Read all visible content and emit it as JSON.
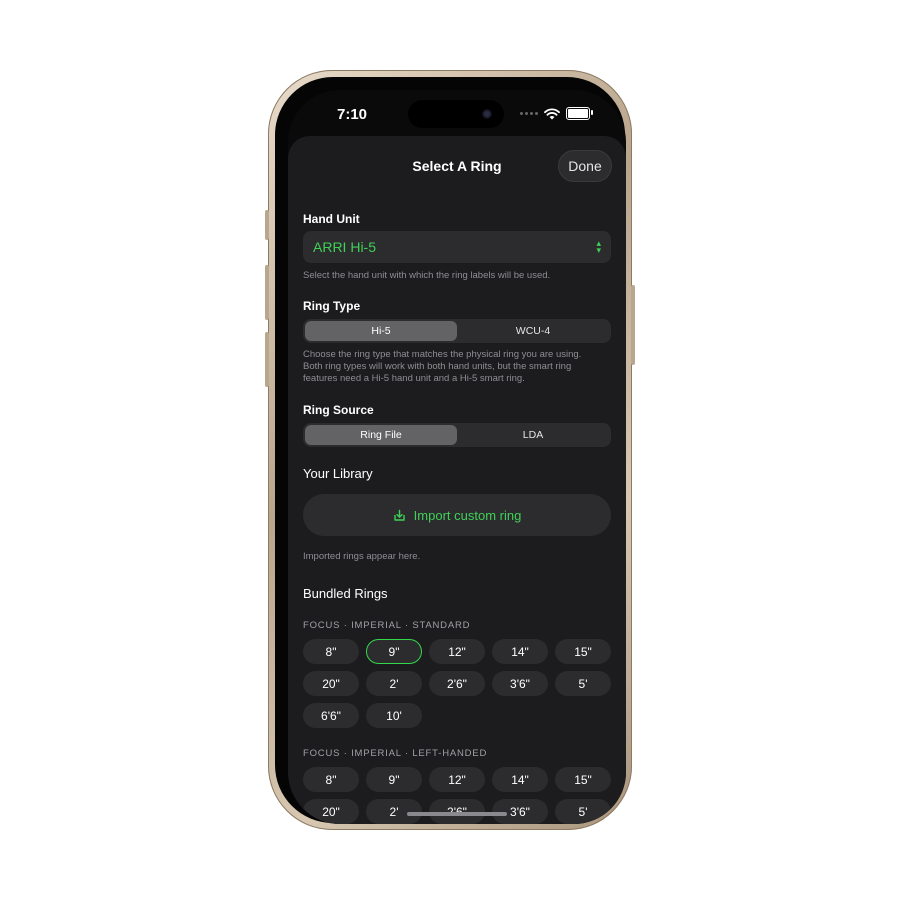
{
  "status_bar": {
    "time": "7:10"
  },
  "header": {
    "title": "Select A Ring",
    "done_label": "Done"
  },
  "hand_unit": {
    "label": "Hand Unit",
    "value": "ARRI Hi-5",
    "helper": "Select the hand unit with which the ring labels will be used."
  },
  "ring_type": {
    "label": "Ring Type",
    "options": [
      "Hi-5",
      "WCU-4"
    ],
    "selected": "Hi-5",
    "helper": "Choose the ring type that matches the physical ring you are using. Both ring types will work with both hand units, but the smart ring features need a Hi-5 hand unit and a Hi-5 smart ring."
  },
  "ring_source": {
    "label": "Ring Source",
    "options": [
      "Ring File",
      "LDA"
    ],
    "selected": "Ring File"
  },
  "library": {
    "title": "Your Library",
    "import_label": "Import custom ring",
    "empty_text": "Imported rings appear here."
  },
  "bundled": {
    "title": "Bundled Rings",
    "groups": [
      {
        "caption": "FOCUS · IMPERIAL · STANDARD",
        "rings": [
          "8\"",
          "9\"",
          "12\"",
          "14\"",
          "15\"",
          "20\"",
          "2'",
          "2'6\"",
          "3'6\"",
          "5'",
          "6'6\"",
          "10'"
        ],
        "selected_index": 1
      },
      {
        "caption": "FOCUS · IMPERIAL · LEFT-HANDED",
        "rings": [
          "8\"",
          "9\"",
          "12\"",
          "14\"",
          "15\"",
          "20\"",
          "2'",
          "2'6\"",
          "3'6\"",
          "5'"
        ],
        "selected_index": -1
      }
    ]
  },
  "colors": {
    "accent": "#32d74b",
    "sheet": "#1c1c1e",
    "control": "#2c2c2e"
  }
}
